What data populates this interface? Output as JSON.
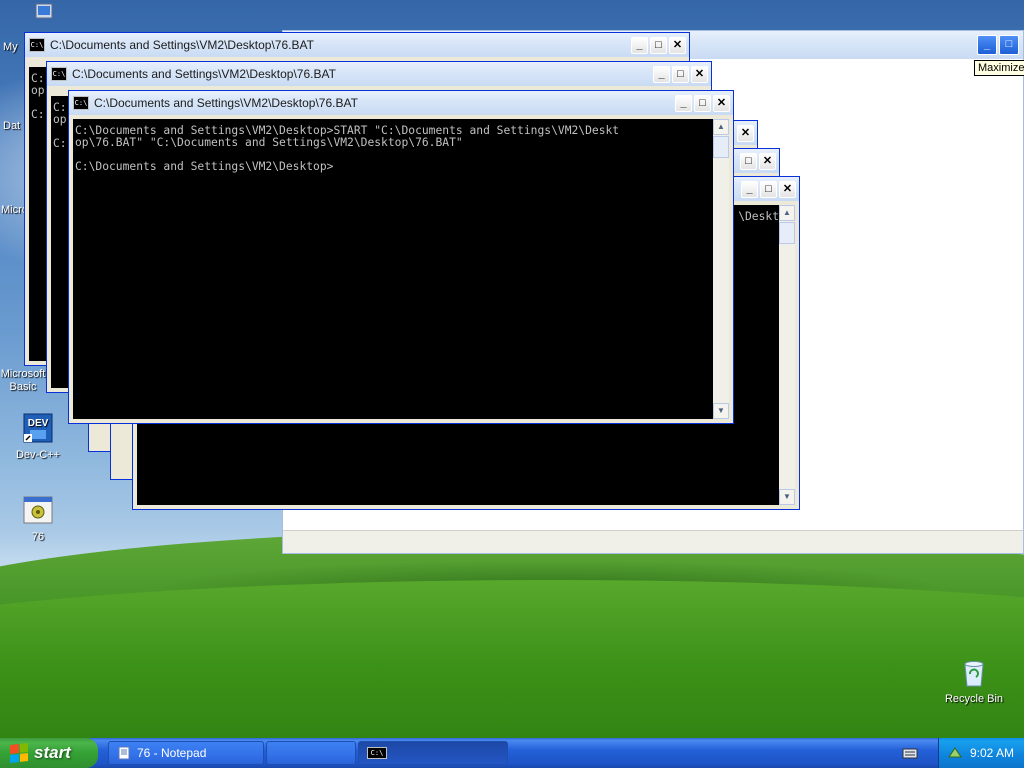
{
  "desktop": {
    "icons": [
      {
        "label": "My"
      },
      {
        "label": "Dat"
      },
      {
        "label": "Micro C"
      },
      {
        "label": "Microsoft Basic"
      },
      {
        "label": "Dev-C++"
      },
      {
        "label": "76"
      },
      {
        "label": "Recycle Bin"
      }
    ]
  },
  "tooltip": {
    "text": "Maximize"
  },
  "windows": {
    "title": "C:\\Documents and Settings\\VM2\\Desktop\\76.BAT",
    "front_console": "C:\\Documents and Settings\\VM2\\Desktop>START \"C:\\Documents and Settings\\VM2\\Deskt\nop\\76.BAT\" \"C:\\Documents and Settings\\VM2\\Desktop\\76.BAT\"\n\nC:\\Documents and Settings\\VM2\\Desktop>",
    "back1_console": "C:\nop\n\nC:",
    "back2_console": "C:\nop\n\nC:",
    "right_console": "\\Deskt"
  },
  "taskbar": {
    "start_label": "start",
    "items": [
      {
        "label": "76 - Notepad"
      },
      {
        "label": ""
      },
      {
        "label": ""
      }
    ],
    "clock": "9:02 AM"
  },
  "colors": {
    "title_active": "#0653d8",
    "console_bg": "#000000",
    "console_text": "#c0c0c0",
    "taskbar": "#245edb",
    "start_green": "#35a235"
  }
}
